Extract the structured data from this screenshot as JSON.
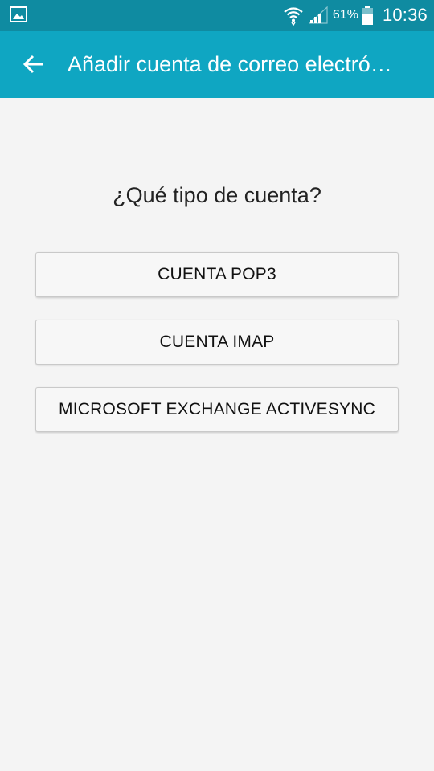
{
  "status_bar": {
    "battery_percent": "61%",
    "time": "10:36",
    "icons": [
      "gallery-icon",
      "wifi-icon",
      "signal-icon",
      "battery-icon"
    ]
  },
  "app_bar": {
    "title": "Añadir cuenta de correo electró…",
    "back_icon": "arrow-left-icon",
    "color": "#0fa6c2"
  },
  "content": {
    "question": "¿Qué tipo de cuenta?",
    "options": [
      {
        "label": "CUENTA POP3"
      },
      {
        "label": "CUENTA IMAP"
      },
      {
        "label": "MICROSOFT EXCHANGE ACTIVESYNC"
      }
    ]
  },
  "colors": {
    "status_bar": "#0f8ba1",
    "background": "#f4f4f4"
  }
}
